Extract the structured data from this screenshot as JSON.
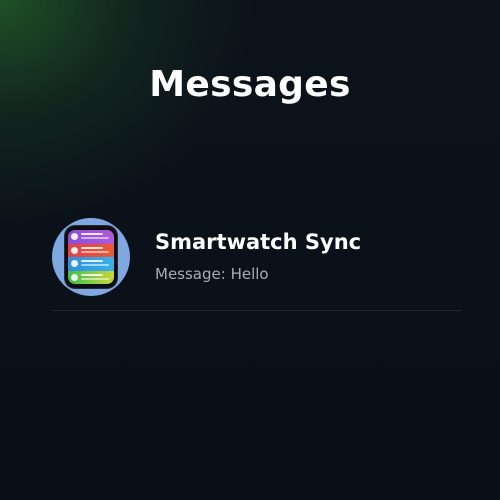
{
  "header": {
    "title": "Messages"
  },
  "conversations": [
    {
      "name": "Smartwatch Sync",
      "preview": "Message: Hello",
      "avatar_icon": "smartwatch-icon"
    }
  ],
  "colors": {
    "background": "#0b1118",
    "accent_glow": "#225c28",
    "title_text": "#ffffff",
    "preview_text": "#a8adb5",
    "avatar_bg": "#7fa7e0"
  }
}
